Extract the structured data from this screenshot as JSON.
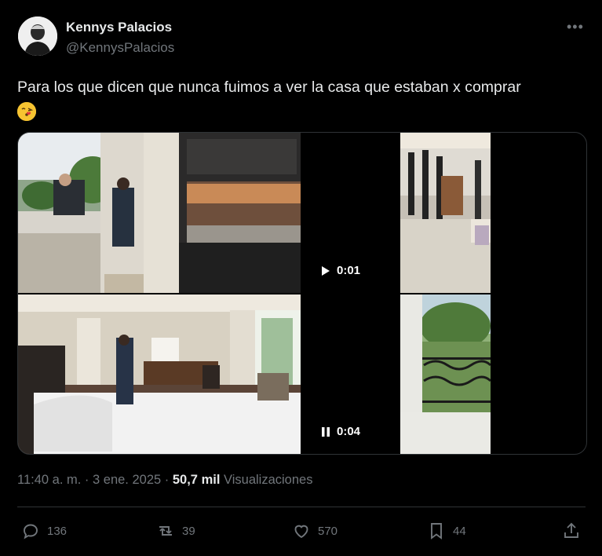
{
  "author": {
    "name": "Kennys Palacios",
    "handle": "@KennysPalacios"
  },
  "more_icon": "more-dots-icon",
  "tweet": {
    "text": "Para los que dicen que nunca fuimos a ver la casa que estaban x comprar",
    "emoji": "face-blowing-kiss"
  },
  "media": {
    "video1": {
      "state": "play",
      "time": "0:01"
    },
    "video2": {
      "state": "pause",
      "time": "0:04"
    }
  },
  "meta": {
    "time": "11:40 a. m.",
    "sep": "·",
    "date": "3 ene. 2025",
    "views_count": "50,7 mil",
    "views_label": "Visualizaciones"
  },
  "actions": {
    "replies": "136",
    "retweets": "39",
    "likes": "570",
    "bookmarks": "44"
  },
  "colors": {
    "background": "#000000",
    "text": "#e7e9ea",
    "secondary": "#71767b",
    "border": "#2f3336"
  }
}
